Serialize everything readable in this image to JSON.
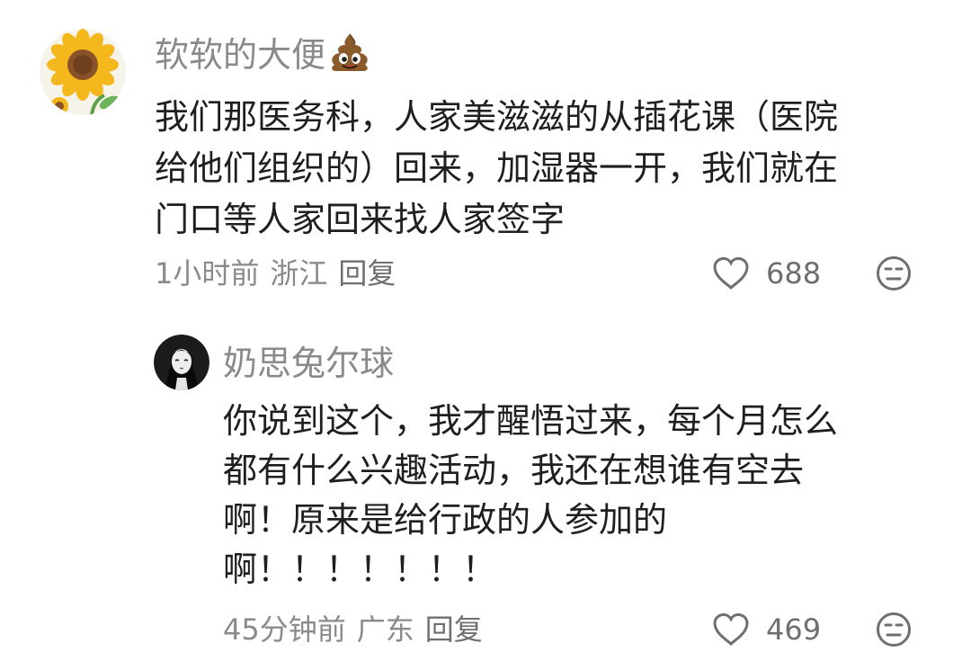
{
  "comments": [
    {
      "username": "软软的大便",
      "username_emoji": "pile-of-poo",
      "text_lines": [
        "我们那医务科，人家美滋滋的从插花课（医院",
        "给他们组织的）回来，加湿器一开，我们就在",
        "门口等人家回来找人家签字"
      ],
      "time": "1小时前",
      "location": "浙江",
      "reply_label": "回复",
      "likes": "688",
      "avatar": "sunflower-avatar"
    },
    {
      "username": "奶思兔尔球",
      "text_lines": [
        "你说到这个，我才醒悟过来，每个月怎么",
        "都有什么兴趣活动，我还在想谁有空去",
        "啊！原来是给行政的人参加的",
        "啊！！！！！！！"
      ],
      "time": "45分钟前",
      "location": "广东",
      "reply_label": "回复",
      "likes": "469",
      "avatar": "anime-girl-avatar"
    }
  ],
  "colors": {
    "text_primary": "#1f1f1f",
    "text_secondary": "#8a8a8a",
    "icon": "#6f6f6f"
  }
}
